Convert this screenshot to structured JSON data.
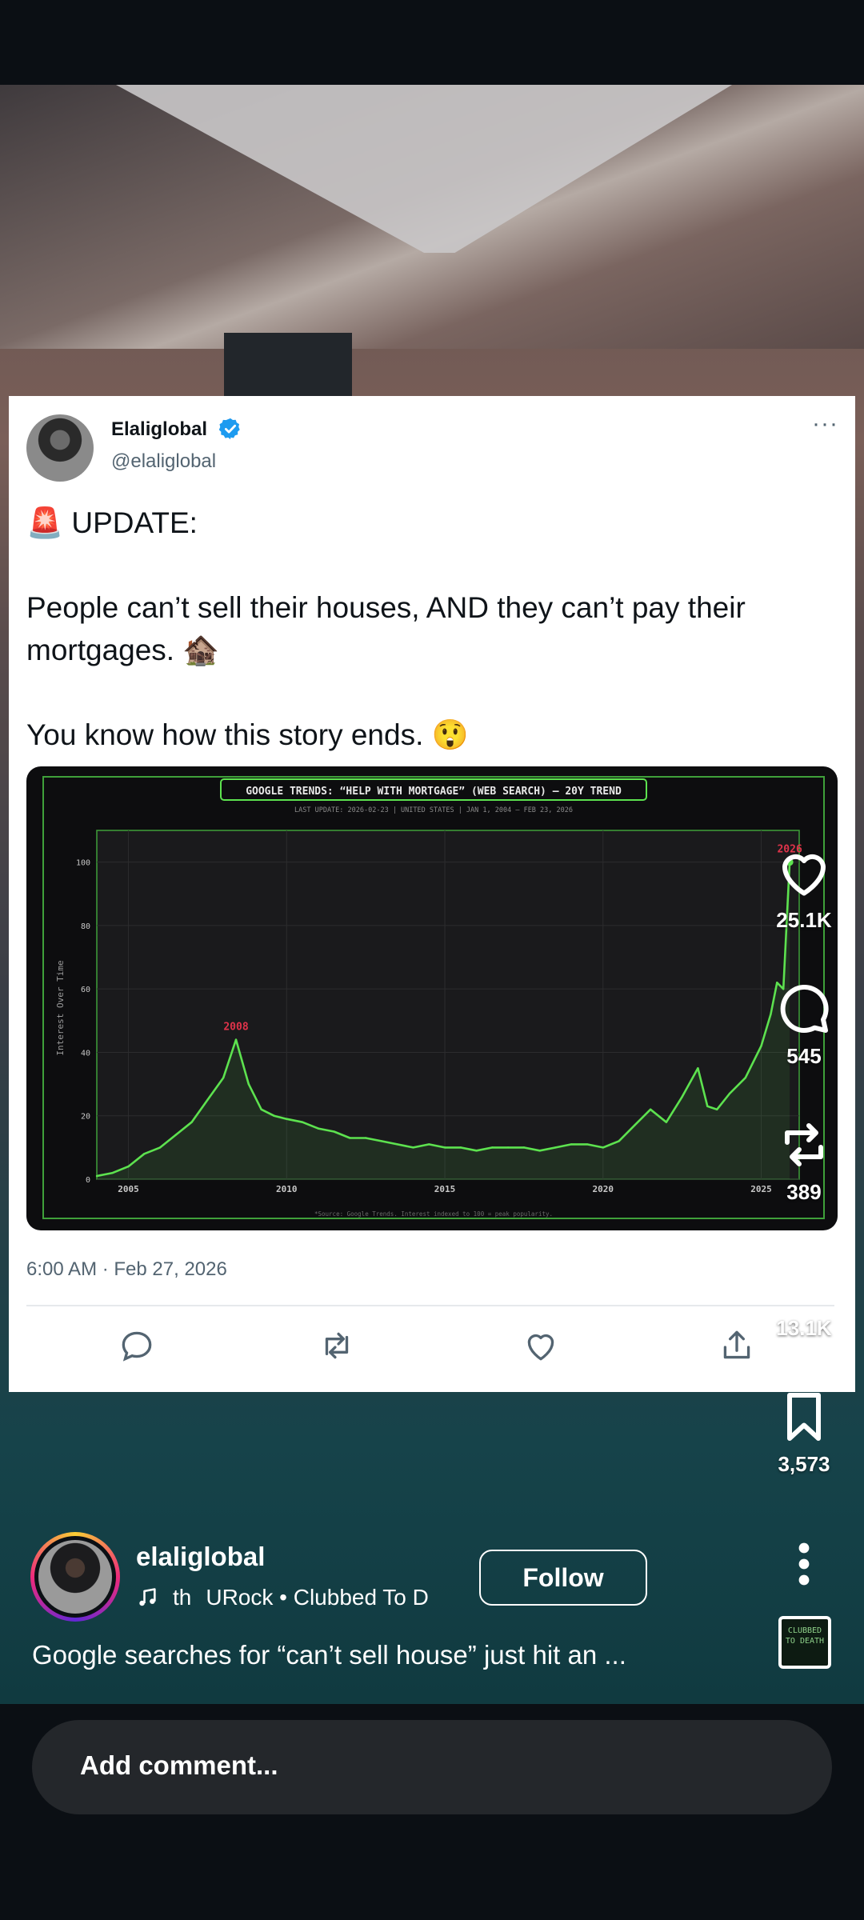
{
  "tweet": {
    "display_name": "Elaliglobal",
    "handle": "@elaliglobal",
    "more_label": "···",
    "text": "🚨 UPDATE:\n\nPeople can’t sell their houses, AND they can’t pay their mortgages. 🏚️\n\nYou know how this story ends. 😲",
    "timestamp": "6:00 AM · Feb 27, 2026"
  },
  "chart_data": {
    "type": "area",
    "title": "GOOGLE TRENDS: “HELP WITH MORTGAGE” (WEB SEARCH) – 20Y TREND",
    "subtitle": "LAST UPDATE: 2026-02-23  |  UNITED STATES  |  JAN 1, 2004 – FEB 23, 2026",
    "ylabel": "Interest Over Time",
    "xlabel": "",
    "source": "*Source: Google Trends. Interest indexed to 100 = peak popularity.",
    "xlim": [
      2004,
      2026.2
    ],
    "ylim": [
      0,
      110
    ],
    "x_ticks": [
      2005,
      2010,
      2015,
      2020,
      2025
    ],
    "y_ticks": [
      0,
      20,
      40,
      60,
      80,
      100
    ],
    "annotations": [
      {
        "label": "2008",
        "x": 2008.4,
        "y": 44
      },
      {
        "label": "2026",
        "x": 2025.9,
        "y": 100
      }
    ],
    "colors": {
      "line": "#5de24f",
      "frame": "#3fa03a",
      "annotation": "#e0334a",
      "background": "#1a1a1c"
    },
    "x": [
      2004.0,
      2004.5,
      2005.0,
      2005.5,
      2006.0,
      2006.5,
      2007.0,
      2007.5,
      2008.0,
      2008.4,
      2008.8,
      2009.2,
      2009.6,
      2010.0,
      2010.5,
      2011.0,
      2011.5,
      2012.0,
      2012.5,
      2013.0,
      2013.5,
      2014.0,
      2014.5,
      2015.0,
      2015.5,
      2016.0,
      2016.5,
      2017.0,
      2017.5,
      2018.0,
      2018.5,
      2019.0,
      2019.5,
      2020.0,
      2020.5,
      2021.0,
      2021.5,
      2022.0,
      2022.5,
      2023.0,
      2023.3,
      2023.6,
      2024.0,
      2024.5,
      2025.0,
      2025.3,
      2025.5,
      2025.7,
      2025.9
    ],
    "y": [
      1,
      2,
      4,
      8,
      10,
      14,
      18,
      25,
      32,
      44,
      30,
      22,
      20,
      19,
      18,
      16,
      15,
      13,
      13,
      12,
      11,
      10,
      11,
      10,
      10,
      9,
      10,
      10,
      10,
      9,
      10,
      11,
      11,
      10,
      12,
      17,
      22,
      18,
      26,
      35,
      23,
      22,
      27,
      32,
      42,
      52,
      62,
      60,
      100
    ]
  },
  "rail": {
    "likes": "25.1K",
    "comments": "545",
    "reposts": "389",
    "shares": "13.1K",
    "saves": "3,573"
  },
  "reel": {
    "username": "elaliglobal",
    "audio_prefix": "th",
    "audio_track": "URock • Clubbed To D",
    "follow_label": "Follow",
    "caption": "Google searches for “can’t sell house” just hit an ...",
    "album_art_text": "CLUBBED TO DEATH"
  },
  "comment": {
    "placeholder": "Add comment..."
  }
}
